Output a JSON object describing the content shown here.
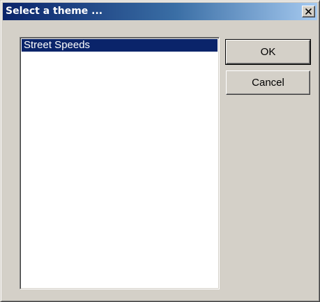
{
  "window": {
    "title": "Select a theme ...",
    "close_icon": "close-icon"
  },
  "theme_list": {
    "items": [
      {
        "label": "Street Speeds",
        "selected": true
      }
    ]
  },
  "buttons": {
    "ok_label": "OK",
    "cancel_label": "Cancel"
  },
  "colors": {
    "titlebar_start": "#0a246a",
    "titlebar_end": "#a6caf0",
    "selection": "#0a246a",
    "face": "#d4d0c8"
  }
}
